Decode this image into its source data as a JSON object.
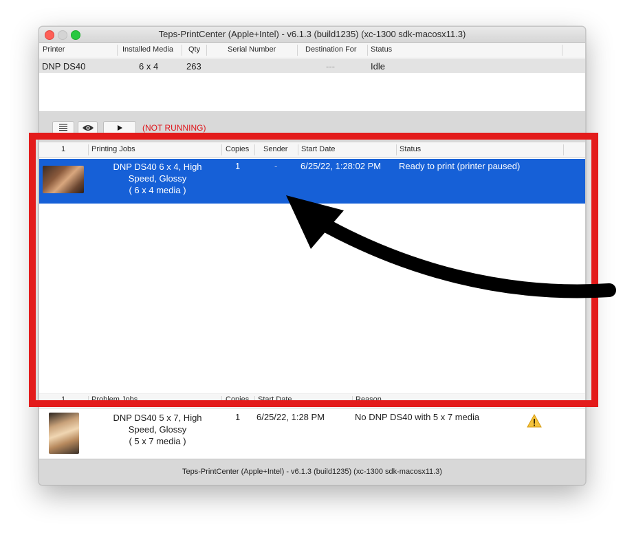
{
  "window": {
    "title": "Teps-PrintCenter (Apple+Intel) - v6.1.3  (build1235)  (xc-1300 sdk-macosx11.3)",
    "footer": "Teps-PrintCenter (Apple+Intel) - v6.1.3  (build1235)  (xc-1300 sdk-macosx11.3)"
  },
  "printers": {
    "columns": [
      "Printer",
      "Installed Media",
      "Qty",
      "Serial Number",
      "Destination For",
      "Status"
    ],
    "row": {
      "printer": "DNP DS40",
      "media": "6 x 4",
      "qty": "263",
      "serial": "",
      "destination": "---",
      "status": "Idle"
    }
  },
  "toolbar": {
    "status": "(NOT RUNNING)"
  },
  "jobs": {
    "columns": [
      "1",
      "Printing Jobs",
      "Copies",
      "Sender",
      "Start Date",
      "Status"
    ],
    "row": {
      "line1": "DNP DS40 6 x 4, High",
      "line2": "Speed, Glossy",
      "line3": "( 6 x 4 media )",
      "copies": "1",
      "sender": "-",
      "start_date": "6/25/22, 1:28:02 PM",
      "status": "Ready to print (printer paused)"
    }
  },
  "problems": {
    "columns": [
      "1",
      "Problem Jobs",
      "Copies",
      "Start Date",
      "Reason"
    ],
    "row": {
      "line1": "DNP DS40 5 x 7, High",
      "line2": "Speed, Glossy",
      "line3": "( 5 x 7 media )",
      "copies": "1",
      "start_date": "6/25/22, 1:28 PM",
      "reason": "No DNP DS40 with 5 x 7 media"
    }
  },
  "colors": {
    "selection": "#1660d7",
    "annotation_red": "#e31b1b",
    "not_running": "#e0141a"
  },
  "icons": [
    "list-icon",
    "eye-icon",
    "play-icon",
    "warning-icon",
    "arrow-annotation"
  ]
}
